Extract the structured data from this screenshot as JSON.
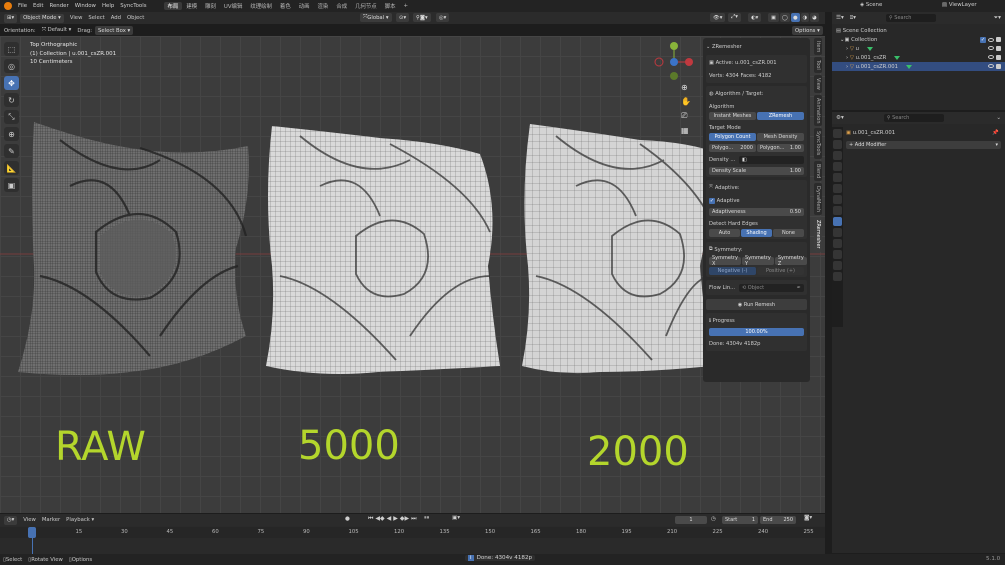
{
  "topbar": {
    "menus": [
      "File",
      "Edit",
      "Render",
      "Window",
      "Help",
      "SyncTools"
    ],
    "workspaces": [
      "布局",
      "建模",
      "雕刻",
      "UV编辑",
      "纹理绘制",
      "着色",
      "动画",
      "渲染",
      "合成",
      "几何节点",
      "脚本"
    ],
    "active_workspace_index": 0,
    "scene": "Scene",
    "view_layer": "ViewLayer"
  },
  "viewport_header": {
    "mode": "Object Mode",
    "menus": [
      "View",
      "Select",
      "Add",
      "Object"
    ],
    "transform": "Global",
    "options": "Options"
  },
  "tool_settings": {
    "orientation_label": "Orientation:",
    "orientation_value": "Default",
    "drag_label": "Drag:",
    "drag_value": "Select Box"
  },
  "overlay": {
    "view": "Top Orthographic",
    "collection": "(1) Collection | u.001_csZR.001",
    "scale": "10 Centimeters"
  },
  "labels": {
    "raw": "RAW",
    "five_k": "5000",
    "two_k": "2000"
  },
  "npanel": {
    "header": "ZRemesher",
    "active": "Active: u.001_csZR.001",
    "stats": "Verts: 4304  Faces: 4182",
    "algo_section": "Algorithm / Target:",
    "algorithm_label": "Algorithm",
    "algo_options": [
      "Instant Meshes",
      "ZRemesh"
    ],
    "algo_selected": 1,
    "target_mode_label": "Target Mode",
    "target_options": [
      "Polygon Count",
      "Mesh Density"
    ],
    "target_selected": 0,
    "polygon_label_1": "Polygo...",
    "polygon_value_1": "2000",
    "polygon_label_2": "Polygon...",
    "polygon_value_2": "1.00",
    "density_label": "Density ...",
    "density_scale_label": "Density Scale",
    "density_scale_value": "1.00",
    "adaptive_section": "Adaptive:",
    "adaptive_check": "Adaptive",
    "adaptiveness_label": "Adaptiveness",
    "adaptiveness_value": "0.50",
    "hard_edges_label": "Detect Hard Edges",
    "hard_edges_options": [
      "Auto",
      "Shading",
      "None"
    ],
    "hard_edges_selected": 1,
    "symmetry_section": "Symmetry:",
    "symmetry_options": [
      "Symmetry X",
      "Symmetry Y",
      "Symmetry Z"
    ],
    "neg_label": "Negative (-)",
    "pos_label": "Positive (+)",
    "flow_label": "Flow Lin...",
    "flow_placeholder": "Object",
    "run_button": "Run Remesh",
    "progress_section": "Progress",
    "progress_text": "100.00%",
    "progress_fraction": 1.0,
    "done_text": "Done: 4304v 4182p"
  },
  "ntabs": [
    "Item",
    "Tool",
    "View",
    "Animation",
    "SyncTools",
    "Blend",
    "DynaMesh",
    "ZRemesher"
  ],
  "outliner": {
    "search_placeholder": "Search",
    "scene_collection": "Scene Collection",
    "collection": "Collection",
    "objects": [
      "u",
      "u.001_csZR",
      "u.001_csZR.001"
    ]
  },
  "properties": {
    "search_placeholder": "Search",
    "object_name": "u.001_csZR.001",
    "add_modifier": "Add Modifier"
  },
  "timeline": {
    "menus": [
      "View",
      "Marker",
      "Playback"
    ],
    "current_frame": "1",
    "start_label": "Start",
    "start_value": "1",
    "end_label": "End",
    "end_value": "250",
    "ticks": [
      "1",
      "15",
      "30",
      "45",
      "60",
      "75",
      "90",
      "105",
      "120",
      "135",
      "150",
      "165",
      "180",
      "195",
      "210",
      "225",
      "240",
      "255"
    ]
  },
  "statusbar": {
    "select": "Select",
    "rotate": "Rotate View",
    "options": "Options",
    "done": "Done: 4304v 4182p",
    "version": "5.1.0"
  },
  "colors": {
    "accent": "#4772b3",
    "label_green": "#b4d62c",
    "viewport": "#3c3c3c"
  }
}
